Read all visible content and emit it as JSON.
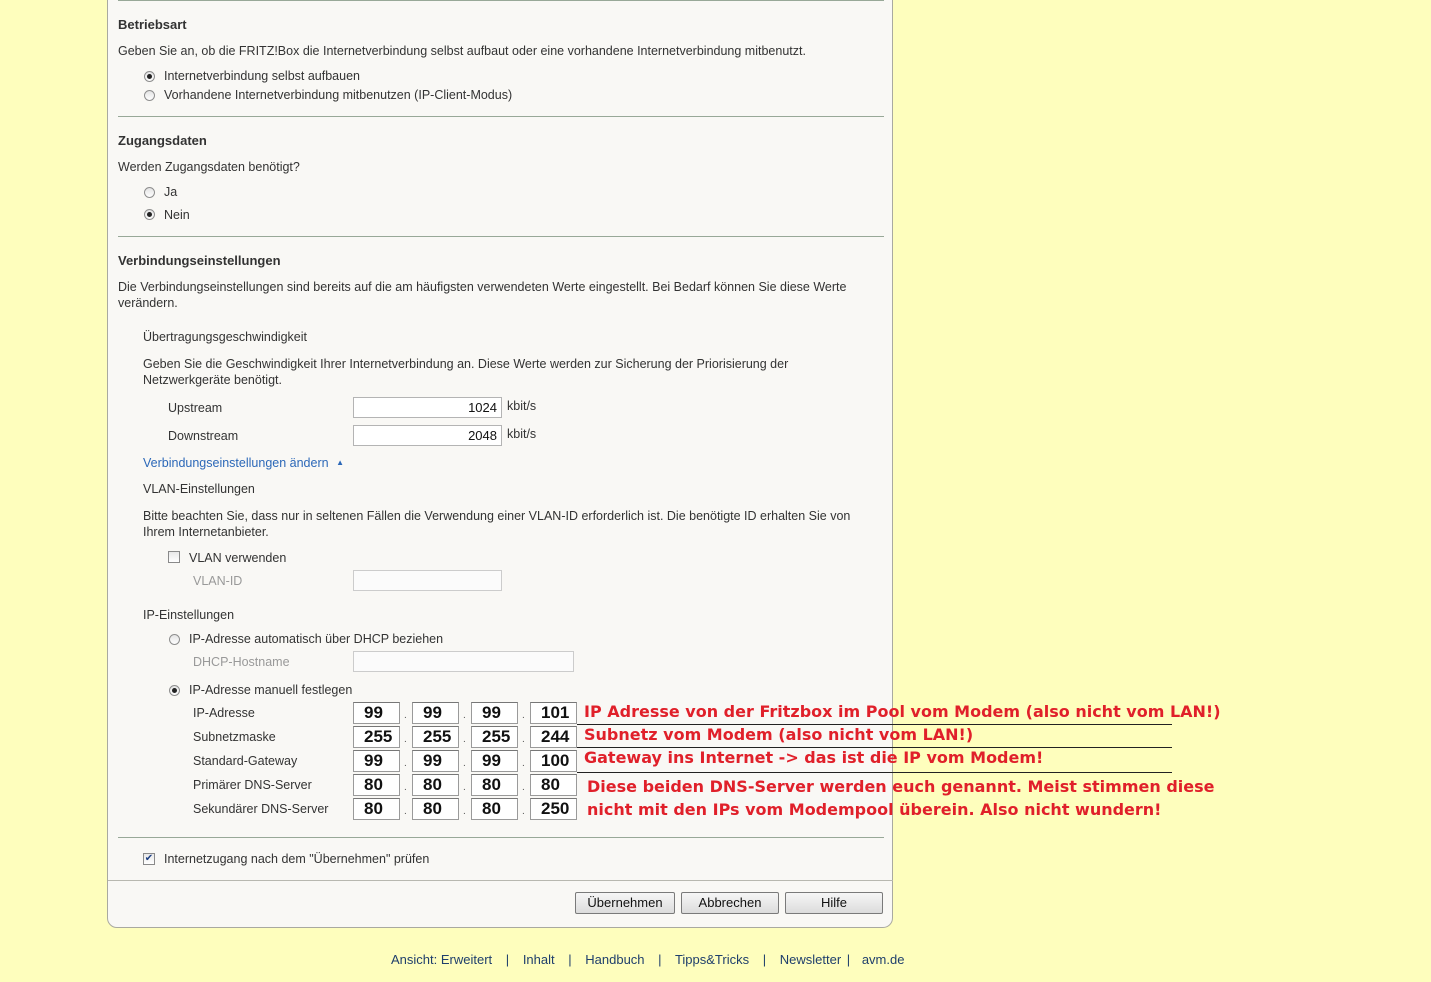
{
  "betriebsart": {
    "heading": "Betriebsart",
    "description": "Geben Sie an, ob die FRITZ!Box die Internetverbindung selbst aufbaut oder eine vorhandene Internetverbindung mitbenutzt.",
    "options": [
      {
        "label": "Internetverbindung selbst aufbauen",
        "selected": true
      },
      {
        "label": "Vorhandene Internetverbindung mitbenutzen (IP-Client-Modus)",
        "selected": false
      }
    ]
  },
  "zugangsdaten": {
    "heading": "Zugangsdaten",
    "question": "Werden Zugangsdaten benötigt?",
    "options": [
      {
        "label": "Ja",
        "selected": false
      },
      {
        "label": "Nein",
        "selected": true
      }
    ]
  },
  "verbindung": {
    "heading": "Verbindungseinstellungen",
    "description_line1": "Die Verbindungseinstellungen sind bereits auf die am häufigsten verwendeten Werte eingestellt. Bei Bedarf können Sie diese Werte",
    "description_line2": "verändern.",
    "speed_heading": "Übertragungsgeschwindigkeit",
    "speed_desc_line1": "Geben Sie die Geschwindigkeit Ihrer Internetverbindung an. Diese Werte werden zur Sicherung der Priorisierung der",
    "speed_desc_line2": "Netzwerkgeräte benötigt.",
    "upstream_label": "Upstream",
    "upstream_value": "1024",
    "downstream_label": "Downstream",
    "downstream_value": "2048",
    "unit": "kbit/s",
    "change_link": "Verbindungseinstellungen ändern",
    "vlan_heading": "VLAN-Einstellungen",
    "vlan_desc_line1": "Bitte beachten Sie, dass nur in seltenen Fällen die Verwendung einer VLAN-ID erforderlich ist. Die benötigte ID erhalten Sie von",
    "vlan_desc_line2": "Ihrem Internetanbieter.",
    "vlan_checkbox": "VLAN verwenden",
    "vlan_id_label": "VLAN-ID",
    "vlan_id_value": "",
    "ip_heading": "IP-Einstellungen",
    "dhcp_option": "IP-Adresse automatisch über DHCP beziehen",
    "dhcp_hostname_label": "DHCP-Hostname",
    "dhcp_hostname_value": "",
    "manual_option": "IP-Adresse manuell festlegen",
    "ip_rows": [
      {
        "label": "IP-Adresse",
        "octets": [
          "99",
          "99",
          "99",
          "101"
        ]
      },
      {
        "label": "Subnetzmaske",
        "octets": [
          "255",
          "255",
          "255",
          "244"
        ]
      },
      {
        "label": "Standard-Gateway",
        "octets": [
          "99",
          "99",
          "99",
          "100"
        ]
      },
      {
        "label": "Primärer DNS-Server",
        "octets": [
          "80",
          "80",
          "80",
          "80"
        ]
      },
      {
        "label": "Sekundärer DNS-Server",
        "octets": [
          "80",
          "80",
          "80",
          "250"
        ]
      }
    ]
  },
  "check_label": "Internetzugang nach dem \"Übernehmen\" prüfen",
  "buttons": {
    "apply": "Übernehmen",
    "cancel": "Abbrechen",
    "help": "Hilfe"
  },
  "annotations": {
    "ip": "IP Adresse von der Fritzbox im Pool vom Modem (also nicht vom LAN!)",
    "subnet": "Subnetz vom Modem (also nicht vom LAN!)",
    "gateway": "Gateway ins Internet -> das ist die IP vom Modem!",
    "dns_line1": "Diese beiden DNS-Server werden euch genannt. Meist stimmen diese",
    "dns_line2": "nicht mit den IPs vom Modempool überein. Also nicht wundern!"
  },
  "footer": {
    "view_prefix": "Ansicht:",
    "view_link": "Erweitert",
    "links": [
      "Inhalt",
      "Handbuch",
      "Tipps&Tricks",
      "Newsletter"
    ],
    "site": "avm.de"
  },
  "colors": {
    "page_background": "#fefebd",
    "panel_background": "#f9f8f5",
    "annotation_red": "#e0202a",
    "link_blue": "#2c68b8"
  }
}
